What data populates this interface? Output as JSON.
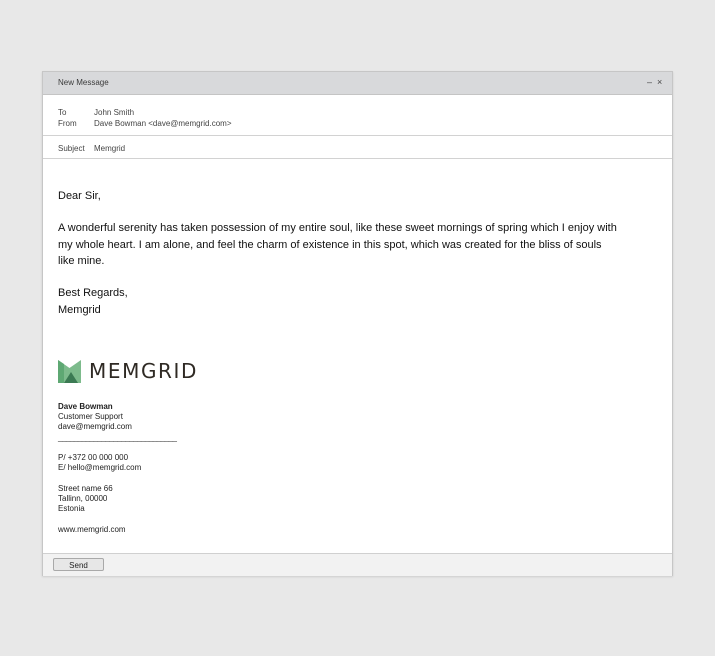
{
  "window": {
    "title": "New Message",
    "minimize": "–",
    "close": "×"
  },
  "headers": {
    "to_label": "To",
    "to_value": "John Smith",
    "from_label": "From",
    "from_value": "Dave Bowman <dave@memgrid.com>",
    "subject_label": "Subject",
    "subject_value": "Memgrid"
  },
  "body": {
    "greeting": "Dear Sir,",
    "paragraph": "A wonderful serenity has taken possession of my entire soul, like these sweet mornings of spring which I enjoy with my whole heart. I am alone, and feel the charm of existence in this spot, which was created for the bliss of souls like mine.",
    "regards": "Best Regards,",
    "signoff": "Memgrid"
  },
  "signature": {
    "logo_text": "MEMGRID",
    "name": "Dave Bowman",
    "role": "Customer Support",
    "email": "dave@memgrid.com",
    "separator": "______________________________",
    "phone": "P/ +372 00 000 000",
    "email_line": "E/ hello@memgrid.com",
    "street": "Street name 66",
    "city": "Tallinn, 00000",
    "country": "Estonia",
    "website": "www.memgrid.com"
  },
  "footer": {
    "send_label": "Send"
  },
  "colors": {
    "logo_green_light": "#7dbb8c",
    "logo_green_dark": "#3b7a53"
  }
}
